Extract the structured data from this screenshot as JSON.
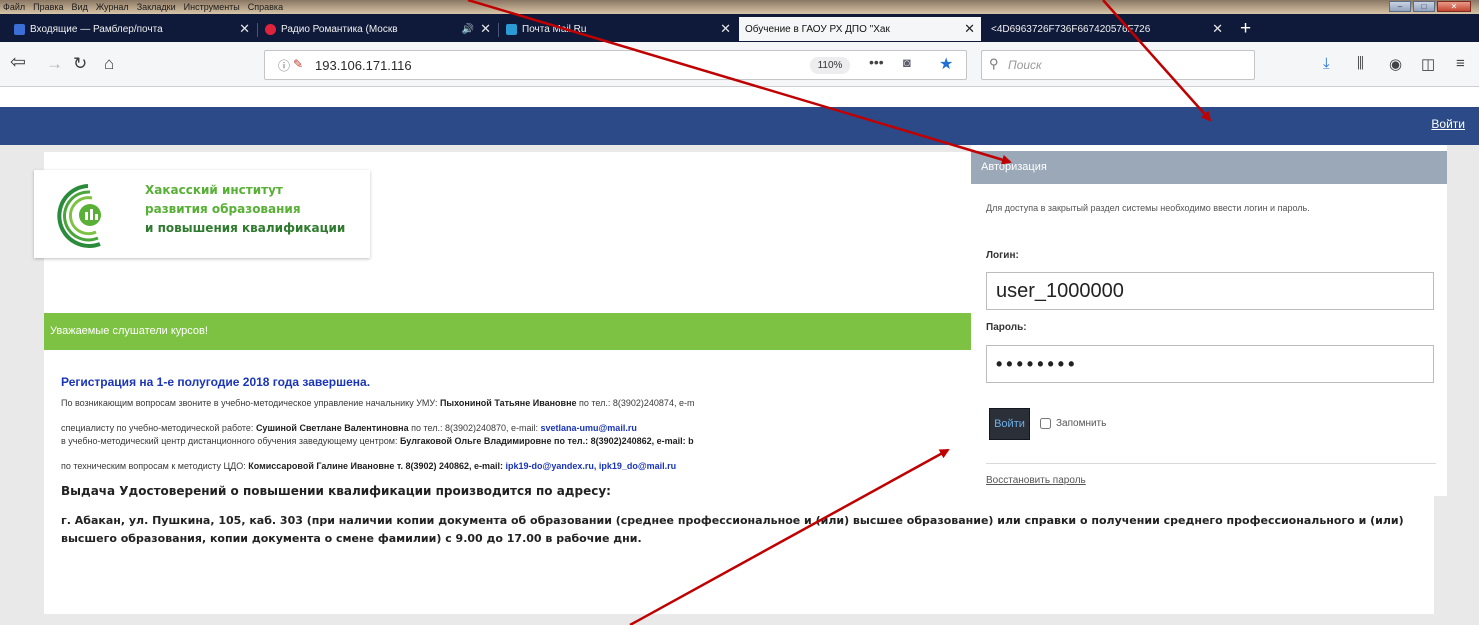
{
  "browser": {
    "menu": [
      "Файл",
      "Правка",
      "Вид",
      "Журнал",
      "Закладки",
      "Инструменты",
      "Справка"
    ],
    "tabs": [
      {
        "title": "Входящие — Рамблер/почта",
        "favicon_color": "#3b6fd6"
      },
      {
        "title": "Радио Романтика (Москв",
        "favicon_color": "#e0233c",
        "sound": "🔊"
      },
      {
        "title": "Почта Mail.Ru",
        "favicon_color": "#2b9bd6"
      },
      {
        "title": "Обучение в ГАОУ РХ ДПО \"Хак",
        "favicon_color": "#cfcfcf",
        "active": true
      },
      {
        "title": "<4D6963726F736F667420576F726",
        "favicon_color": "#5a5a5a"
      }
    ],
    "new_tab": "+",
    "url": "193.106.171.116",
    "zoom": "110%",
    "search_placeholder": "Поиск"
  },
  "header": {
    "login_link": "Войти"
  },
  "logo": {
    "line1": "Хакасский институт",
    "line2": "развития образования",
    "line3": "и повышения квалификации"
  },
  "notice": {
    "title": "Уважаемые слушатели курсов!",
    "registration": "Регистрация на 1-е полугодие 2018 года завершена.",
    "line_a_prefix": "По возникающим вопросам звоните в учебно-методическое управление начальнику УМУ: ",
    "line_a_name": "Пыхониной Татьяне Ивановне",
    "line_a_suffix": " по тел.: 8(3902)240874, e-m",
    "line_b_prefix": "специалисту по учебно-методической работе: ",
    "line_b_name": "Сушиной Светлане Валентиновна",
    "line_b_mid": " по тел.: 8(3902)240870, e-mail: ",
    "line_b_mail": "svetlana-umu@mail.ru",
    "line_c_prefix": "в учебно-методический центр дистанционного обучения заведующему центром: ",
    "line_c_name": "Булгаковой Ольге Владимировне",
    "line_c_suffix": " по тел.: 8(3902)240862, e-mail: b",
    "line_d_prefix": "по техническим вопросам к методисту ЦДО: ",
    "line_d_name": "Комиссаровой Галине Ивановне т. 8(3902) 240862, e-mail: ",
    "line_d_mail": "ipk19-do@yandex.ru,   ipk19_do@mail.ru",
    "issue_title": "Выдача Удостоверений о повышении квалификации производится по адресу:",
    "address": "г. Абакан, ул. Пушкина, 105, каб. 303 (при наличии копии документа об образовании (среднее профессиональное и (или) высшее образование) или справки о получении среднего профессионального и (или) высшего образования, копии документа о смене фамилии) с 9.00 до 17.00 в рабочие дни."
  },
  "auth": {
    "title": "Авторизация",
    "description": "Для доступа в закрытый раздел системы необходимо ввести логин и пароль.",
    "login_label": "Логин:",
    "login_value": "user_1000000",
    "password_label": "Пароль:",
    "password_value": "••••••••",
    "submit": "Войти",
    "remember": "Запомнить",
    "restore": "Восстановить пароль"
  }
}
